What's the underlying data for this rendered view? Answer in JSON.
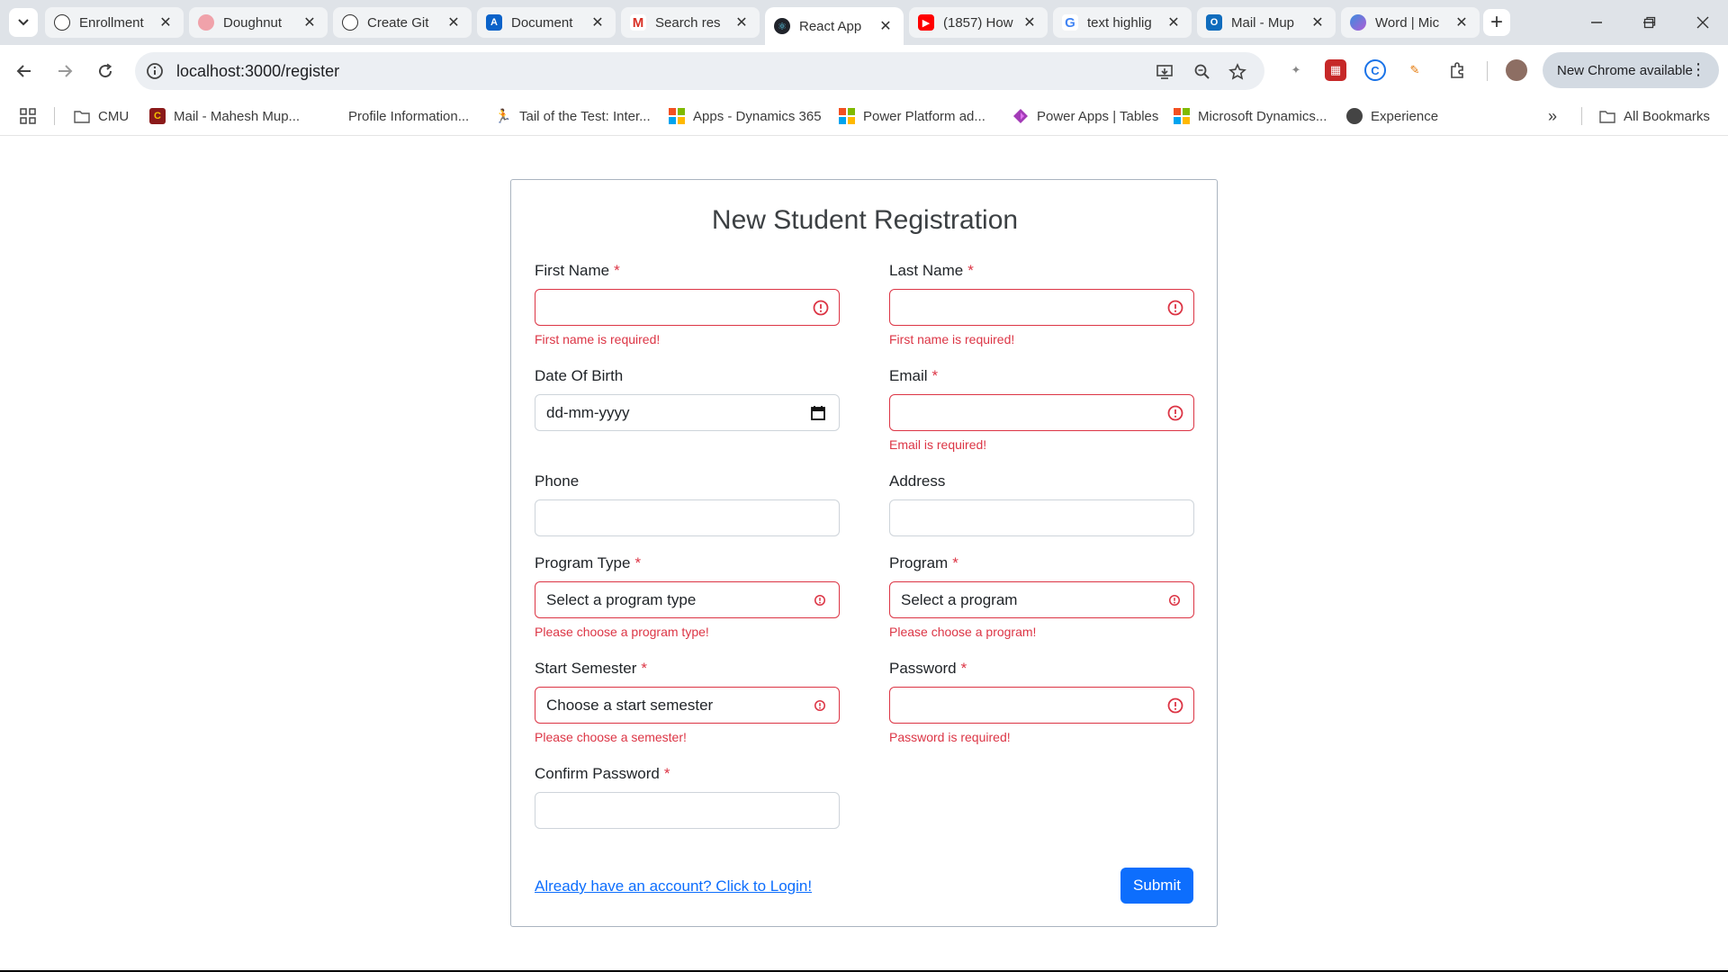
{
  "browser": {
    "tabs": [
      {
        "title": "Enrollment",
        "favicon": "openai-icon",
        "color": "#1a1a1a"
      },
      {
        "title": "Doughnut",
        "favicon": "chart-icon",
        "color": "#e05561"
      },
      {
        "title": "Create Git",
        "favicon": "openai-icon",
        "color": "#1a1a1a"
      },
      {
        "title": "Document",
        "favicon": "azure-icon",
        "color": "#0a62c9"
      },
      {
        "title": "Search res",
        "favicon": "gmail-icon",
        "color": "#d93025"
      },
      {
        "title": "React App",
        "favicon": "react-icon",
        "color": "#149eca"
      },
      {
        "title": "(1857) How",
        "favicon": "youtube-icon",
        "color": "#ff0000"
      },
      {
        "title": "text highlig",
        "favicon": "google-icon",
        "color": "#4285f4"
      },
      {
        "title": "Mail - Mup",
        "favicon": "outlook-icon",
        "color": "#0f6cbd"
      },
      {
        "title": "Word | Mic",
        "favicon": "copilot-icon",
        "color": "#7b61ff"
      }
    ],
    "url": "localhost:3000/register",
    "new_chrome_label": "New Chrome available",
    "bookmarks": [
      {
        "label": "CMU",
        "icon": "folder-icon"
      },
      {
        "label": "Mail - Mahesh Mup...",
        "icon": "cmu-icon"
      },
      {
        "label": "Profile Information...",
        "icon": "apple-icon"
      },
      {
        "label": "Tail of the Test: Inter...",
        "icon": "runner-icon"
      },
      {
        "label": "Apps - Dynamics 365",
        "icon": "microsoft-icon"
      },
      {
        "label": "Power Platform ad...",
        "icon": "microsoft-icon"
      },
      {
        "label": "Power Apps | Tables",
        "icon": "powerapps-icon"
      },
      {
        "label": "Microsoft Dynamics...",
        "icon": "microsoft-icon"
      },
      {
        "label": "Experience",
        "icon": "globe-icon"
      }
    ],
    "all_bookmarks_label": "All Bookmarks"
  },
  "form": {
    "title": "New Student Registration",
    "fields": {
      "first_name": {
        "label": "First Name",
        "required": "*",
        "value": "",
        "error": "First name is required!"
      },
      "last_name": {
        "label": "Last Name",
        "required": "*",
        "value": "",
        "error": "First name is required!"
      },
      "dob": {
        "label": "Date Of Birth",
        "value": "dd-mm-yyyy"
      },
      "email": {
        "label": "Email",
        "required": "*",
        "value": "",
        "error": "Email is required!"
      },
      "phone": {
        "label": "Phone",
        "value": ""
      },
      "address": {
        "label": "Address",
        "value": ""
      },
      "program_type": {
        "label": "Program Type",
        "required": "*",
        "value": "Select a program type",
        "error": "Please choose a program type!"
      },
      "program": {
        "label": "Program",
        "required": "*",
        "value": "Select a program",
        "error": "Please choose a program!"
      },
      "start_semester": {
        "label": "Start Semester",
        "required": "*",
        "value": "Choose a start semester",
        "error": "Please choose a semester!"
      },
      "password": {
        "label": "Password",
        "required": "*",
        "value": "",
        "error": "Password is required!"
      },
      "confirm_password": {
        "label": "Confirm Password",
        "required": "*",
        "value": ""
      }
    },
    "login_link": "Already have an account? Click to Login!",
    "submit_label": "Submit"
  },
  "colors": {
    "error": "#dc3545",
    "primary": "#0d6efd"
  }
}
